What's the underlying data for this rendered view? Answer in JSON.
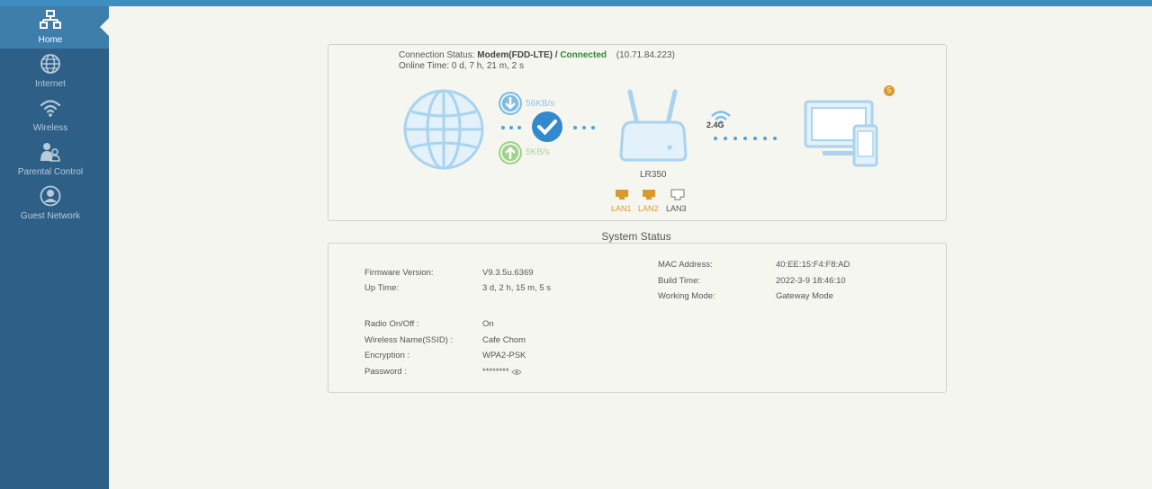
{
  "sidebar": {
    "items": [
      {
        "label": "Home",
        "icon": "network-home-icon"
      },
      {
        "label": "Internet",
        "icon": "globe-icon"
      },
      {
        "label": "Wireless",
        "icon": "wifi-icon"
      },
      {
        "label": "Parental Control",
        "icon": "parental-control-icon"
      },
      {
        "label": "Guest Network",
        "icon": "guest-user-icon"
      }
    ]
  },
  "connection": {
    "status_label": "Connection Status:",
    "mode": "Modem(FDD-LTE) /",
    "state": "Connected",
    "ip": "(10.71.84.223)",
    "online_time": "Online Time: 0 d, 7 h, 21 m, 2 s",
    "download_speed": "56KB/s",
    "upload_speed": "5KB/s",
    "router_name": "LR350",
    "band": "2.4G",
    "client_count": "5",
    "lan_ports": [
      {
        "label": "LAN1",
        "connected": true
      },
      {
        "label": "LAN2",
        "connected": true
      },
      {
        "label": "LAN3",
        "connected": false
      }
    ]
  },
  "system_status": {
    "title": "System Status",
    "left": [
      {
        "key": "Firmware Version:",
        "value": "V9.3.5u.6369"
      },
      {
        "key": "Up Time:",
        "value": "3 d, 2 h, 15 m, 5 s"
      }
    ],
    "right": [
      {
        "key": "MAC Address:",
        "value": "40:EE:15:F4:F8:AD"
      },
      {
        "key": "Build Time:",
        "value": "2022-3-9 18:46:10"
      },
      {
        "key": "Working Mode:",
        "value": "Gateway Mode"
      }
    ],
    "wireless": [
      {
        "key": "Radio On/Off :",
        "value": "On"
      },
      {
        "key": "Wireless Name(SSID) :",
        "value": "Cafe Chom"
      },
      {
        "key": "Encryption :",
        "value": "WPA2-PSK"
      },
      {
        "key": "Password :",
        "value": "********"
      }
    ]
  },
  "colors": {
    "sidebar": "#2e5f86",
    "sidebar_active": "#3e7eab",
    "accent": "#3e8ec2",
    "connected": "#2e8b2e",
    "lan_connected": "#d99a2b"
  }
}
